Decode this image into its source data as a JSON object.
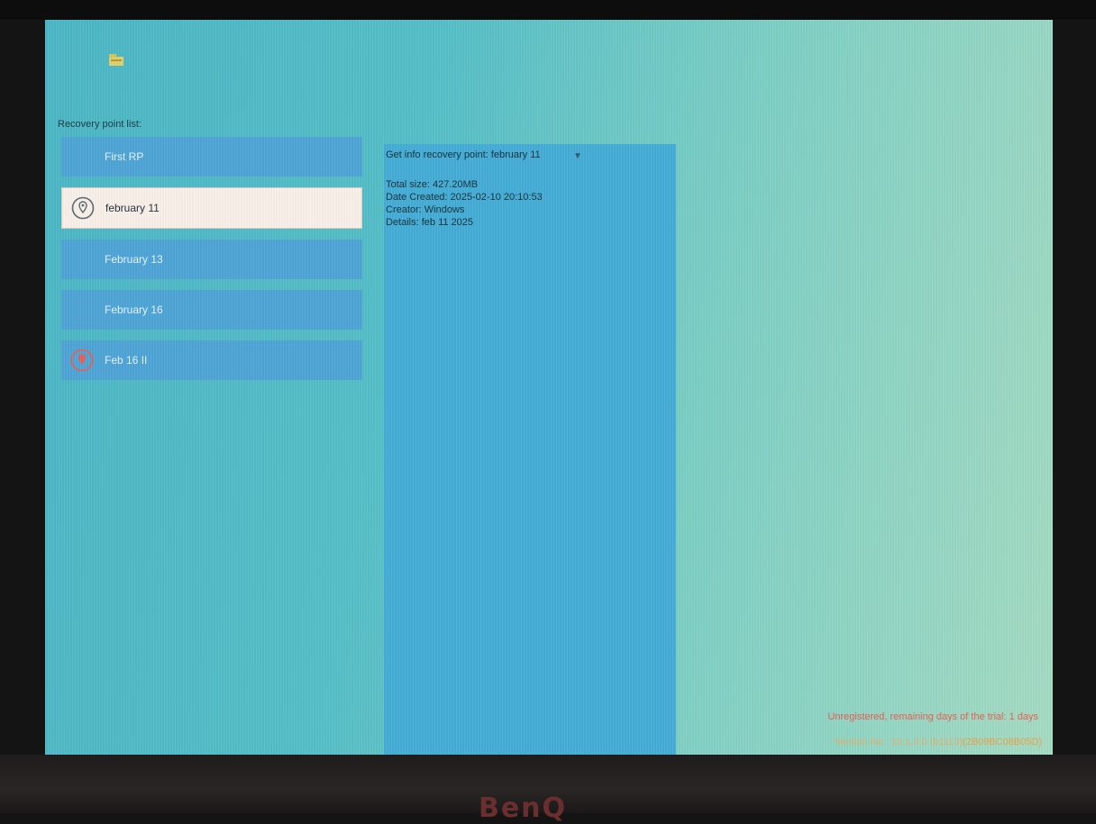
{
  "screen": {
    "list_label": "Recovery point list:",
    "recovery_points": [
      {
        "label": "First RP",
        "state": "normal",
        "icon": ""
      },
      {
        "label": "february 11",
        "state": "selected",
        "icon": "pin-icon"
      },
      {
        "label": "February 13",
        "state": "normal",
        "icon": ""
      },
      {
        "label": "February 16",
        "state": "normal",
        "icon": ""
      },
      {
        "label": "Feb 16 II",
        "state": "normal",
        "icon": "pin-icon"
      }
    ],
    "info": {
      "title": "Get info recovery point: february 11",
      "lines": [
        "Total size: 427.20MB",
        "Date Created: 2025-02-10 20:10:53",
        "Creator: Windows",
        "Details: feb 11 2025"
      ]
    },
    "status_text": "Unregistered, remaining days of the trial: 1 days",
    "version_label": "Version No.: 10.1.0.0 (b1113)",
    "version_id": "(2B09BC08B05D)"
  },
  "monitor": {
    "brand": "BenQ"
  },
  "colors": {
    "screen_bg": "#56c0c9",
    "list_item": "#4ea6d8",
    "selected_item": "#fbf1ea",
    "info_panel": "#46aed8",
    "status_red": "#ef5b50",
    "version_orange": "#e8b06a"
  }
}
